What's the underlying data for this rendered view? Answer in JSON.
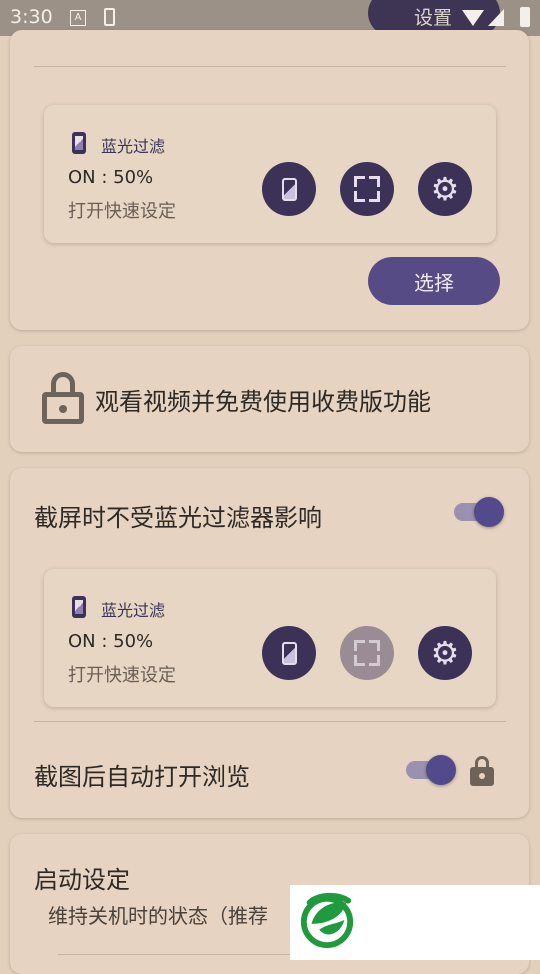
{
  "status_bar": {
    "time": "3:30",
    "notif_a": "A",
    "settings_label": "设置"
  },
  "tiles": [
    {
      "title": "蓝光过滤",
      "status": "ON : 50%",
      "subtitle": "打开快速设定"
    },
    {
      "title": "蓝光过滤",
      "status": "ON : 50%",
      "subtitle": "打开快速设定"
    }
  ],
  "select_button": "选择",
  "promo": {
    "text": "观看视频并免费使用收费版功能"
  },
  "settings": {
    "screenshot_unaffected": {
      "label": "截屏时不受蓝光过滤器影响",
      "enabled": true
    },
    "auto_open_browse": {
      "label": "截图后自动打开浏览",
      "enabled": true,
      "locked": true
    }
  },
  "startup": {
    "title": "启动设定",
    "subtitle": "维持关机时的状态（推荐"
  },
  "colors": {
    "background": "#e2d0bd",
    "accent": "#3c3258",
    "button": "#564b85",
    "toggle_thumb": "#524a8a",
    "disabled_button": "#9a8b94"
  }
}
